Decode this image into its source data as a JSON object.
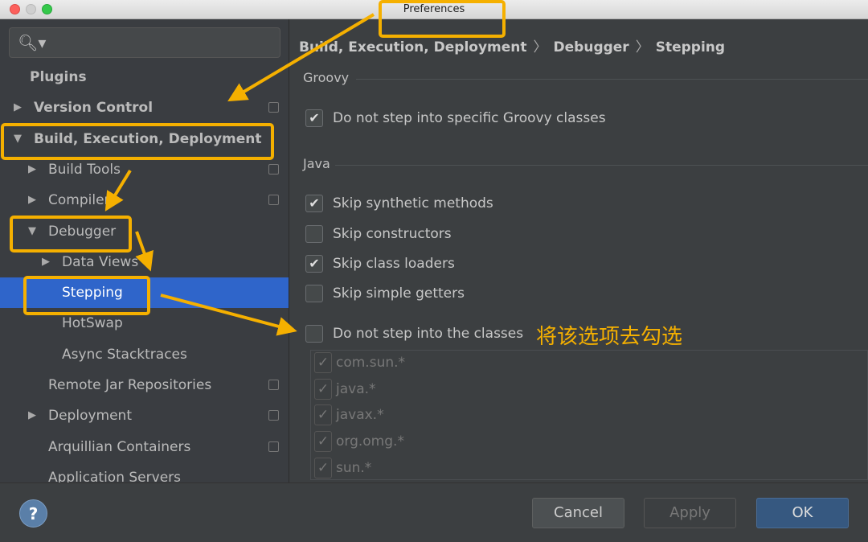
{
  "window": {
    "title": "Preferences"
  },
  "colors": {
    "accent": "#2f65ca",
    "annotation": "#f5b000",
    "ok": "#365880"
  },
  "search": {
    "icon": "search-icon",
    "value": ""
  },
  "sidebar": {
    "items": [
      {
        "label": "Plugins",
        "bold": true,
        "expander": "none"
      },
      {
        "label": "Version Control",
        "bold": true,
        "expander": "collapsed"
      },
      {
        "label": "Build, Execution, Deployment",
        "bold": true,
        "expander": "expanded"
      },
      {
        "label": "Build Tools",
        "expander": "collapsed"
      },
      {
        "label": "Compiler",
        "expander": "collapsed"
      },
      {
        "label": "Debugger",
        "expander": "expanded"
      },
      {
        "label": "Data Views",
        "expander": "collapsed"
      },
      {
        "label": "Stepping",
        "selected": true
      },
      {
        "label": "HotSwap"
      },
      {
        "label": "Async Stacktraces"
      },
      {
        "label": "Remote Jar Repositories"
      },
      {
        "label": "Deployment",
        "expander": "collapsed"
      },
      {
        "label": "Arquillian Containers"
      },
      {
        "label": "Application Servers"
      }
    ]
  },
  "breadcrumb": [
    "Build, Execution, Deployment",
    "Debugger",
    "Stepping"
  ],
  "groovy": {
    "title": "Groovy",
    "options": [
      {
        "label": "Do not step into specific Groovy classes",
        "checked": true
      }
    ]
  },
  "java": {
    "title": "Java",
    "options": [
      {
        "label": "Skip synthetic methods",
        "checked": true
      },
      {
        "label": "Skip constructors",
        "checked": false
      },
      {
        "label": "Skip class loaders",
        "checked": true
      },
      {
        "label": "Skip simple getters",
        "checked": false
      },
      {
        "label": "Do not step into the classes",
        "checked": false
      }
    ]
  },
  "class_filters": [
    {
      "label": "com.sun.*",
      "checked": true
    },
    {
      "label": "java.*",
      "checked": true
    },
    {
      "label": "javax.*",
      "checked": true
    },
    {
      "label": "org.omg.*",
      "checked": true
    },
    {
      "label": "sun.*",
      "checked": true
    }
  ],
  "annotation": {
    "note": "将该选项去勾选"
  },
  "footer": {
    "help": "?",
    "cancel": "Cancel",
    "apply": "Apply",
    "ok": "OK"
  }
}
